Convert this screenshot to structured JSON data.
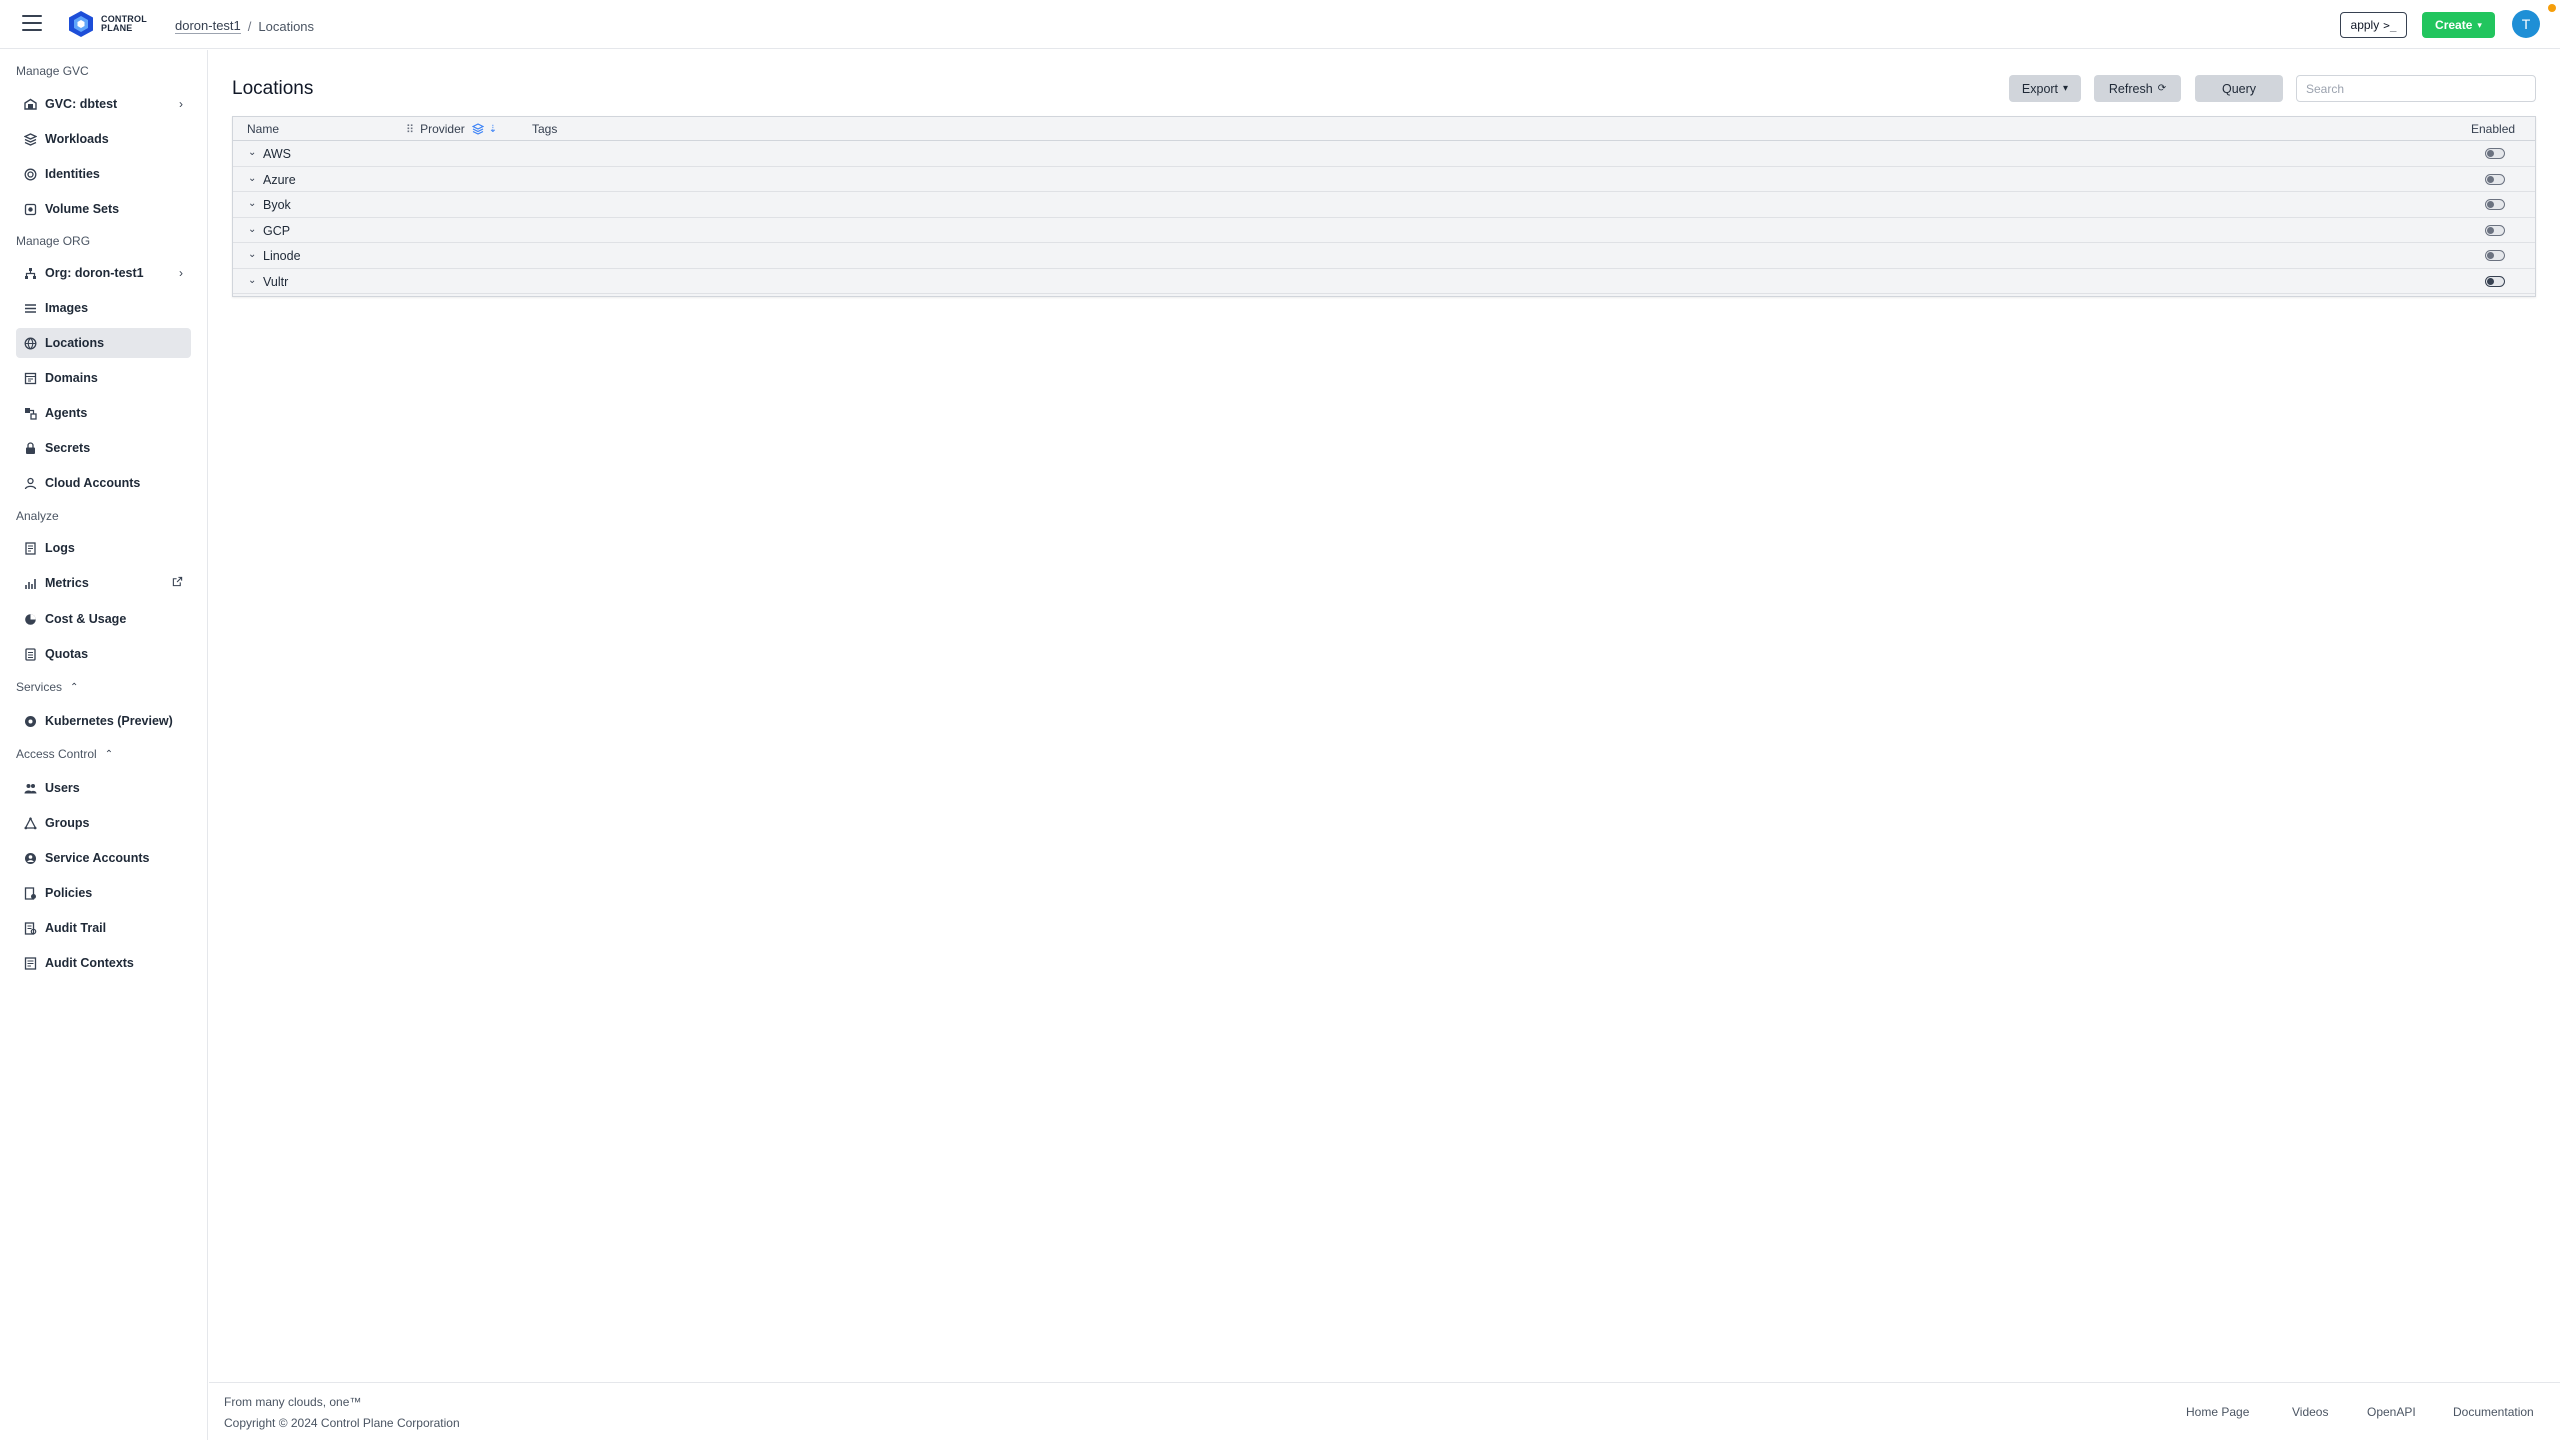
{
  "header": {
    "logo_line1": "CONTROL",
    "logo_line2": "PLANE",
    "breadcrumb": {
      "org": "doron-test1",
      "separator": "/",
      "current": "Locations"
    },
    "apply_label": "apply",
    "apply_icon": ">_",
    "create_label": "Create",
    "avatar_initial": "T",
    "accent_green": "#22c55e",
    "avatar_color": "#1f8fd6"
  },
  "sidebar": {
    "manage_gvc_label": "Manage GVC",
    "gvc_items": [
      {
        "label": "GVC: dbtest",
        "icon": "gvc-icon"
      },
      {
        "label": "Workloads",
        "icon": "workloads-icon"
      },
      {
        "label": "Identities",
        "icon": "identities-icon"
      },
      {
        "label": "Volume Sets",
        "icon": "volume-sets-icon"
      }
    ],
    "manage_org_label": "Manage ORG",
    "org_items": [
      {
        "label": "Org: doron-test1",
        "icon": "org-icon"
      },
      {
        "label": "Images",
        "icon": "images-icon"
      },
      {
        "label": "Locations",
        "icon": "locations-icon",
        "active": true
      },
      {
        "label": "Domains",
        "icon": "domains-icon"
      },
      {
        "label": "Agents",
        "icon": "agents-icon"
      },
      {
        "label": "Secrets",
        "icon": "secrets-icon"
      },
      {
        "label": "Cloud Accounts",
        "icon": "cloud-accounts-icon"
      }
    ],
    "analyze_label": "Analyze",
    "analyze_items": [
      {
        "label": "Logs",
        "icon": "logs-icon"
      },
      {
        "label": "Metrics",
        "icon": "metrics-icon"
      },
      {
        "label": "Cost & Usage",
        "icon": "cost-icon"
      },
      {
        "label": "Quotas",
        "icon": "quotas-icon"
      }
    ],
    "services_label": "Services",
    "services_items": [
      {
        "label": "Kubernetes (Preview)",
        "icon": "kubernetes-icon"
      }
    ],
    "access_label": "Access Control",
    "access_items": [
      {
        "label": "Users",
        "icon": "users-icon"
      },
      {
        "label": "Groups",
        "icon": "groups-icon"
      },
      {
        "label": "Service Accounts",
        "icon": "service-accounts-icon"
      },
      {
        "label": "Policies",
        "icon": "policies-icon"
      },
      {
        "label": "Audit Trail",
        "icon": "audit-trail-icon"
      },
      {
        "label": "Audit Contexts",
        "icon": "audit-contexts-icon"
      }
    ]
  },
  "main": {
    "title": "Locations",
    "toolbar": {
      "export_label": "Export",
      "refresh_label": "Refresh",
      "query_label": "Query",
      "search_placeholder": "Search"
    },
    "table": {
      "columns": {
        "name": "Name",
        "provider": "Provider",
        "tags": "Tags",
        "enabled": "Enabled"
      },
      "groups": [
        {
          "name": "AWS",
          "enabled": false
        },
        {
          "name": "Azure",
          "enabled": false
        },
        {
          "name": "Byok",
          "enabled": false
        },
        {
          "name": "GCP",
          "enabled": false
        },
        {
          "name": "Linode",
          "enabled": false
        },
        {
          "name": "Vultr",
          "enabled": false
        }
      ]
    }
  },
  "footer": {
    "tagline": "From many clouds, one™",
    "copyright": "Copyright © 2024 Control Plane Corporation",
    "links": [
      "Home Page",
      "Videos",
      "OpenAPI",
      "Documentation"
    ]
  }
}
